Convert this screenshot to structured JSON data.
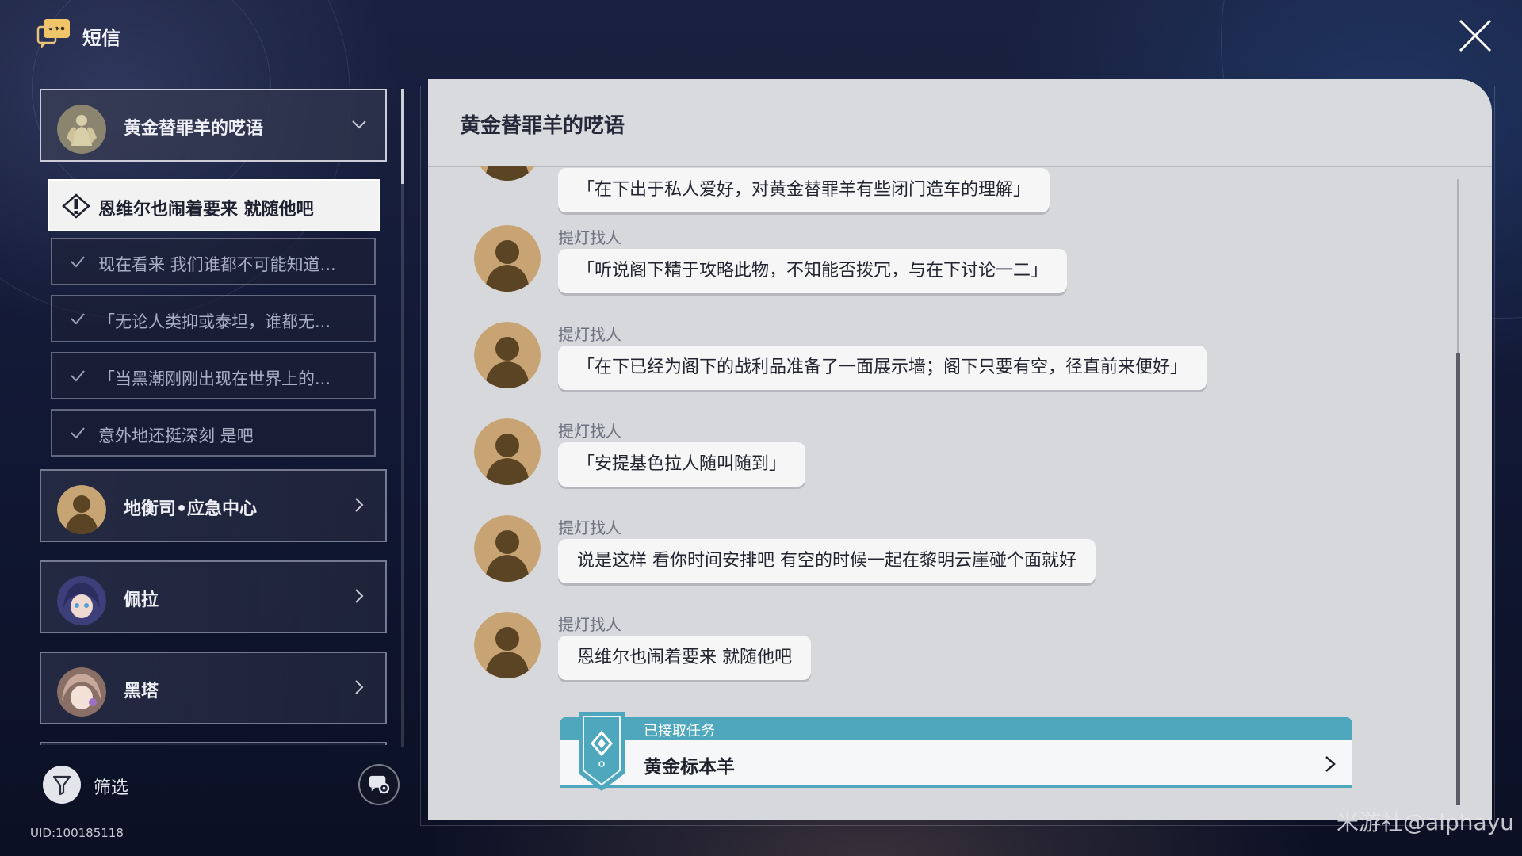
{
  "app": {
    "title": "短信",
    "uid": "UID:100185118",
    "watermark": "米游社@alphayu"
  },
  "sidebar": {
    "contacts": [
      {
        "name": "黄金替罪羊的呓语",
        "expanded": true,
        "threads": [
          {
            "label": "恩维尔也闹着要来 就随他吧",
            "active": true
          },
          {
            "label": "现在看来 我们谁都不可能知道...",
            "done": true
          },
          {
            "label": "「无论人类抑或泰坦，谁都无...",
            "done": true
          },
          {
            "label": "「当黑潮刚刚出现在世界上的...",
            "done": true
          },
          {
            "label": "意外地还挺深刻 是吧",
            "done": true
          }
        ]
      },
      {
        "name": "地衡司•应急中心"
      },
      {
        "name": "佩拉"
      },
      {
        "name": "黑塔"
      }
    ],
    "filter_label": "筛选"
  },
  "chat": {
    "title": "黄金替罪羊的呓语",
    "messages": [
      {
        "sender": "",
        "text": "「在下出于私人爱好，对黄金替罪羊有些闭门造车的理解」"
      },
      {
        "sender": "提灯找人",
        "text": "「听说阁下精于攻略此物，不知能否拨冗，与在下讨论一二」"
      },
      {
        "sender": "提灯找人",
        "text": "「在下已经为阁下的战利品准备了一面展示墙；阁下只要有空，径直前来便好」"
      },
      {
        "sender": "提灯找人",
        "text": "「安提基色拉人随叫随到」"
      },
      {
        "sender": "提灯找人",
        "text": "说是这样 看你时间安排吧 有空的时候一起在黎明云崖碰个面就好"
      },
      {
        "sender": "提灯找人",
        "text": "恩维尔也闹着要来 就随他吧"
      }
    ],
    "quest": {
      "status": "已接取任务",
      "name": "黄金标本羊"
    }
  },
  "colors": {
    "quest_accent": "#4fa7bd",
    "panel_bg": "#d7d8dc",
    "active_thread_bg": "#f2f2f3"
  }
}
